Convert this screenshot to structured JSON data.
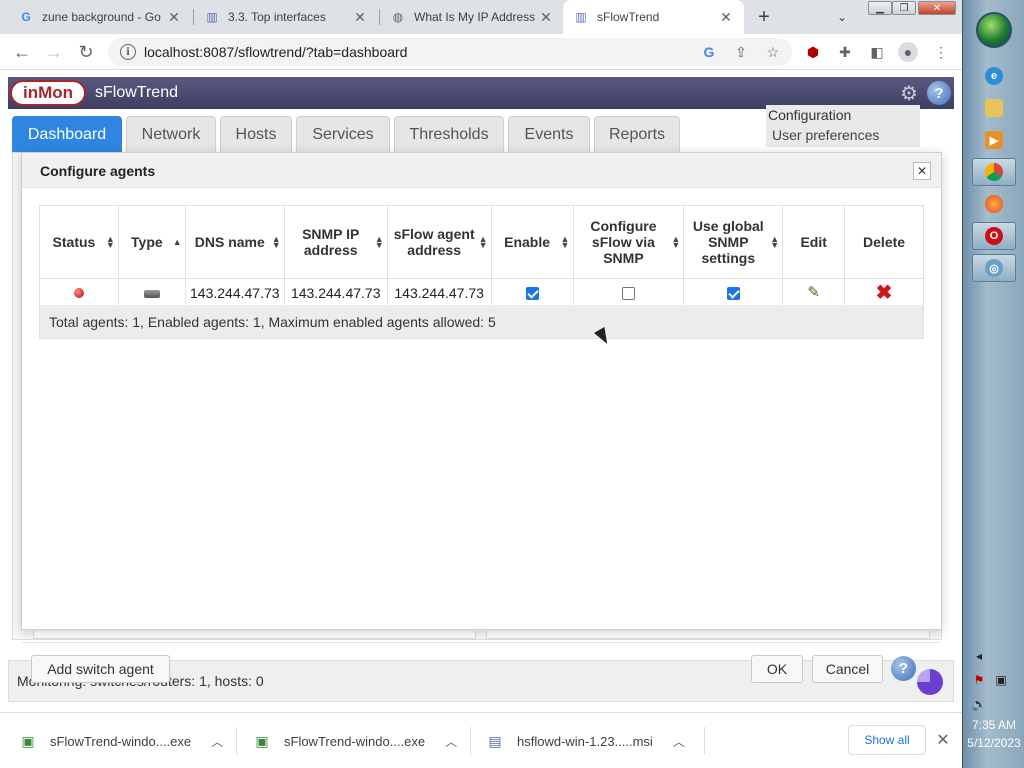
{
  "browser": {
    "tabs": [
      {
        "title": "zune background - Go",
        "icon": "google-g-icon"
      },
      {
        "title": "3.3. Top interfaces",
        "icon": "chart-icon"
      },
      {
        "title": "What Is My IP Address",
        "icon": "globe-icon"
      },
      {
        "title": "sFlowTrend",
        "icon": "chart-icon",
        "active": true
      }
    ],
    "new_tab": "+",
    "url": "localhost:8087/sflowtrend/?tab=dashboard"
  },
  "app": {
    "logo_text": "inMon",
    "title": "sFlowTrend",
    "nav_tabs": [
      "Dashboard",
      "Network",
      "Hosts",
      "Services",
      "Thresholds",
      "Events",
      "Reports"
    ],
    "active_tab": "Dashboard",
    "config_menu": {
      "title": "Configuration",
      "items": [
        "User preferences"
      ]
    },
    "status_text": "Monitoring: switches/routers: 1, hosts: 0",
    "help_glyph": "?"
  },
  "dialog": {
    "title": "Configure agents",
    "columns": [
      "Status",
      "Type",
      "DNS name",
      "SNMP IP address",
      "sFlow agent address",
      "Enable",
      "Configure sFlow via SNMP",
      "Use global SNMP settings",
      "Edit",
      "Delete"
    ],
    "rows": [
      {
        "status": "up",
        "type": "switch",
        "dns_name": "143.244.47.73",
        "snmp_ip": "143.244.47.73",
        "sflow_agent": "143.244.47.73",
        "enable": true,
        "configure_sflow_snmp": false,
        "use_global_snmp": true
      }
    ],
    "footer": "Total agents: 1, Enabled agents: 1, Maximum enabled agents allowed: 5",
    "buttons": {
      "add": "Add switch agent",
      "ok": "OK",
      "cancel": "Cancel"
    }
  },
  "downloads": {
    "items": [
      "sFlowTrend-windo....exe",
      "sFlowTrend-windo....exe",
      "hsflowd-win-1.23.....msi"
    ],
    "show_all": "Show all"
  },
  "taskbar": {
    "time": "7:35 AM",
    "date": "5/12/2023"
  },
  "colors": {
    "active_tab": "#2f86e0",
    "header_bg": "#4b4b72",
    "delete": "#d2161e",
    "status_up": "#c10000"
  }
}
